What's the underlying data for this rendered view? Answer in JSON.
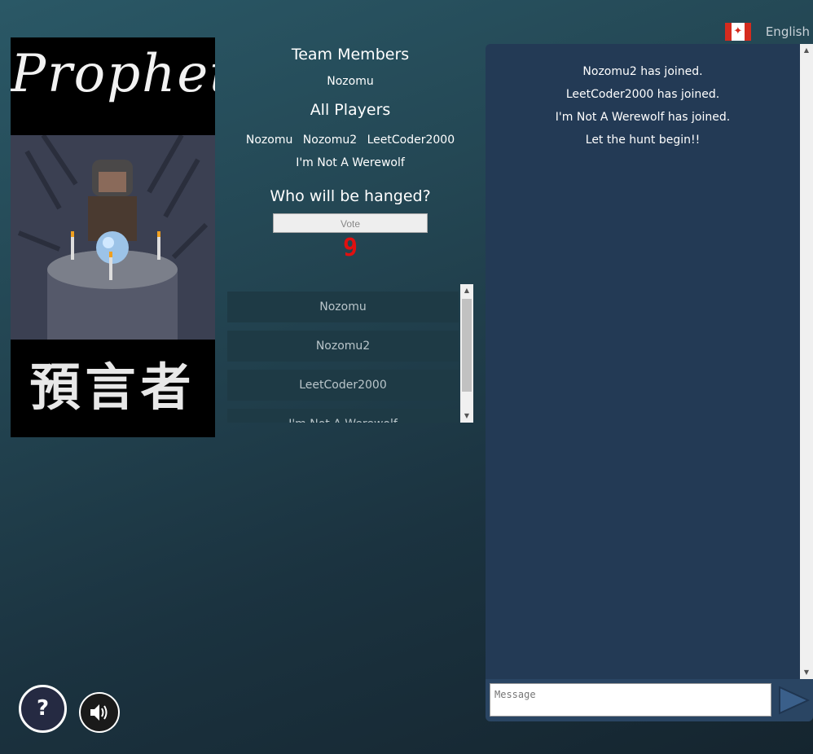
{
  "language": {
    "label": "English",
    "flag": "canada-flag"
  },
  "role_card": {
    "title": "Prophet",
    "kanji": "預言者"
  },
  "team": {
    "heading": "Team Members",
    "members": [
      "Nozomu"
    ]
  },
  "all_players": {
    "heading": "All Players",
    "players": [
      "Nozomu",
      "Nozomu2",
      "LeetCoder2000",
      "I'm Not A Werewolf"
    ]
  },
  "vote": {
    "heading": "Who will be hanged?",
    "button_label": "Vote",
    "timer": "9",
    "timer_color": "#e01010",
    "candidates": [
      "Nozomu",
      "Nozomu2",
      "LeetCoder2000",
      "I'm Not A Werewolf"
    ]
  },
  "chat": {
    "messages": [
      "Nozomu2 has joined.",
      "LeetCoder2000 has joined.",
      "I'm Not A Werewolf has joined.",
      "Let the hunt begin!!"
    ],
    "input_placeholder": "Message"
  },
  "controls": {
    "help_label": "?"
  }
}
